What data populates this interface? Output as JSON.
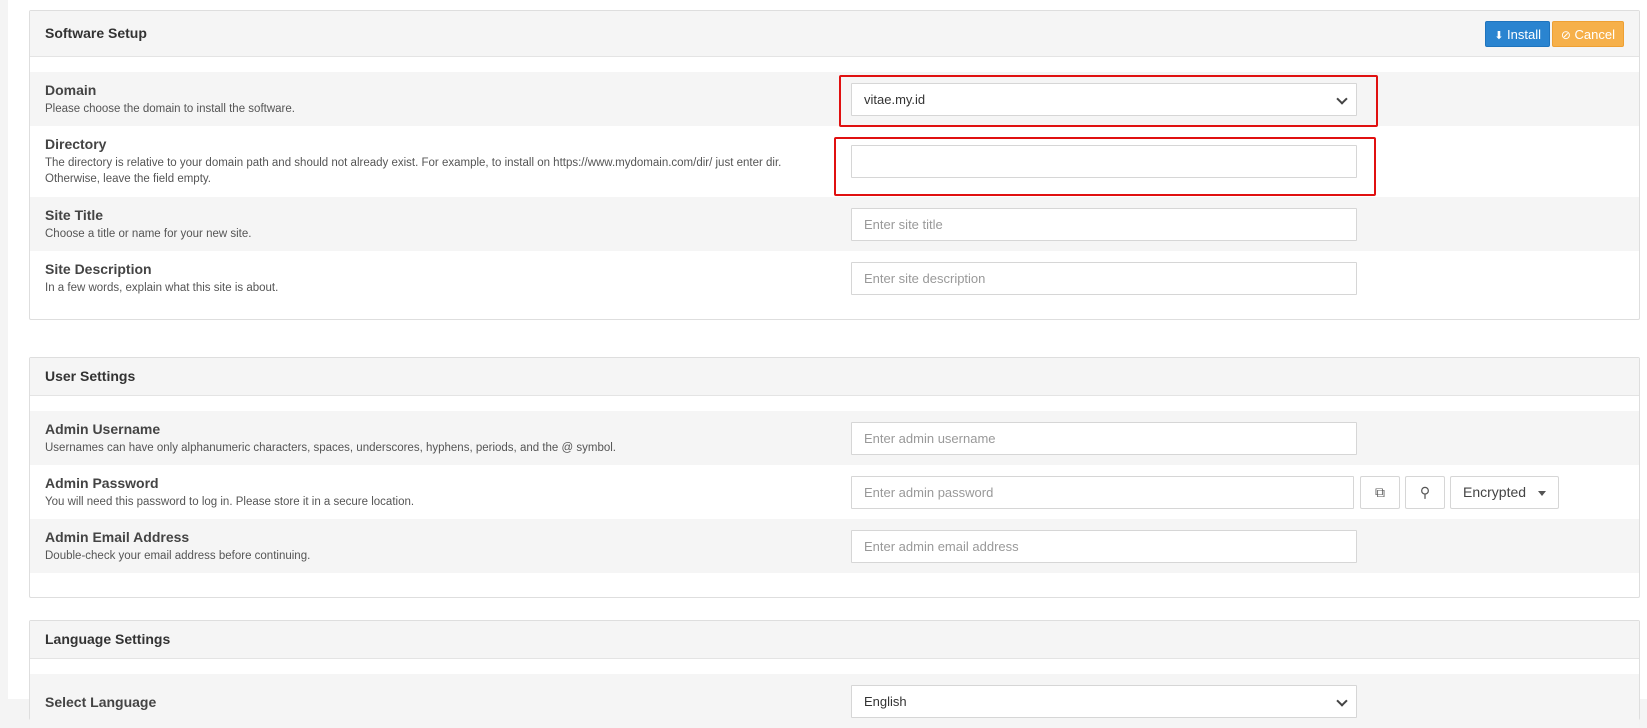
{
  "software_setup": {
    "title": "Software Setup",
    "install_label": "Install",
    "cancel_label": "Cancel",
    "domain": {
      "label": "Domain",
      "description": "Please choose the domain to install the software.",
      "value": "vitae.my.id"
    },
    "directory": {
      "label": "Directory",
      "description": "The directory is relative to your domain path and should not already exist. For example, to install on https://www.mydomain.com/dir/ just enter dir. Otherwise, leave the field empty.",
      "value": ""
    },
    "site_title": {
      "label": "Site Title",
      "description": "Choose a title or name for your new site.",
      "placeholder": "Enter site title"
    },
    "site_description": {
      "label": "Site Description",
      "description": "In a few words, explain what this site is about.",
      "placeholder": "Enter site description"
    }
  },
  "user_settings": {
    "title": "User Settings",
    "admin_username": {
      "label": "Admin Username",
      "description": "Usernames can have only alphanumeric characters, spaces, underscores, hyphens, periods, and the @ symbol.",
      "placeholder": "Enter admin username"
    },
    "admin_password": {
      "label": "Admin Password",
      "description": "You will need this password to log in. Please store it in a secure location.",
      "placeholder": "Enter admin password",
      "mode": "Encrypted"
    },
    "admin_email": {
      "label": "Admin Email Address",
      "description": "Double-check your email address before continuing.",
      "placeholder": "Enter admin email address"
    }
  },
  "language_settings": {
    "title": "Language Settings",
    "select_language": {
      "label": "Select Language",
      "value": "English"
    }
  },
  "colors": {
    "install": "#2a84d0",
    "cancel": "#f6b04a",
    "highlight": "#e01010"
  }
}
